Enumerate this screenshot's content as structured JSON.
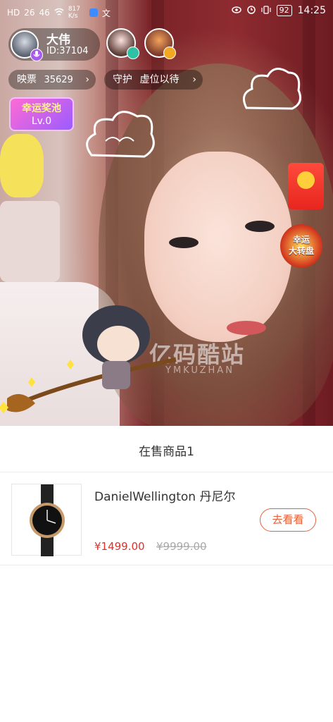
{
  "status_bar": {
    "left_icons": [
      "HD",
      "26",
      "46",
      "817 K/s"
    ],
    "battery": "92",
    "time": "14:25"
  },
  "host": {
    "name": "大伟",
    "id_text": "ID:37104"
  },
  "tickets": {
    "label": "映票",
    "count": "35629"
  },
  "guard": {
    "label": "守护",
    "text": "虚位以待"
  },
  "lottery": {
    "title": "幸运奖池",
    "level": "Lv.0"
  },
  "wheel": {
    "line1": "幸运",
    "line2": "大转盘"
  },
  "watermark": {
    "text": "亿码酷站",
    "sub": "YMKUZHAN"
  },
  "sheet": {
    "title": "在售商品1",
    "product": {
      "name": "DanielWellington 丹尼尔",
      "price": "¥1499.00",
      "original_price": "¥9999.00",
      "button_label": "去看看"
    }
  }
}
